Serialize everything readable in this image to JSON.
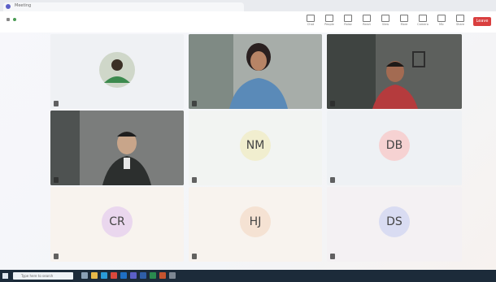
{
  "browser": {
    "tab_title": "Meeting"
  },
  "toolbar": {
    "timer": "",
    "buttons": [
      {
        "label": "Chat"
      },
      {
        "label": "People"
      },
      {
        "label": "Raise"
      },
      {
        "label": "React"
      },
      {
        "label": "View"
      },
      {
        "label": "More"
      },
      {
        "label": "Camera"
      },
      {
        "label": "Mic"
      },
      {
        "label": "Share"
      }
    ],
    "leave_label": "Leave",
    "leave_color": "#d93f3f"
  },
  "participants": [
    {
      "kind": "avatar",
      "name": "",
      "initials": ""
    },
    {
      "kind": "video",
      "name": ""
    },
    {
      "kind": "video",
      "name": ""
    },
    {
      "kind": "video",
      "name": ""
    },
    {
      "kind": "initials",
      "name": "",
      "initials": "NM",
      "color": "#f1eecf"
    },
    {
      "kind": "initials",
      "name": "",
      "initials": "DB",
      "color": "#f6d2d2"
    },
    {
      "kind": "initials",
      "name": "",
      "initials": "CR",
      "color": "#ead7ee"
    },
    {
      "kind": "initials",
      "name": "",
      "initials": "HJ",
      "color": "#f5e2d3"
    },
    {
      "kind": "initials",
      "name": "",
      "initials": "DS",
      "color": "#d9dcf2"
    }
  ],
  "taskbar": {
    "search_placeholder": "Type here to search"
  }
}
